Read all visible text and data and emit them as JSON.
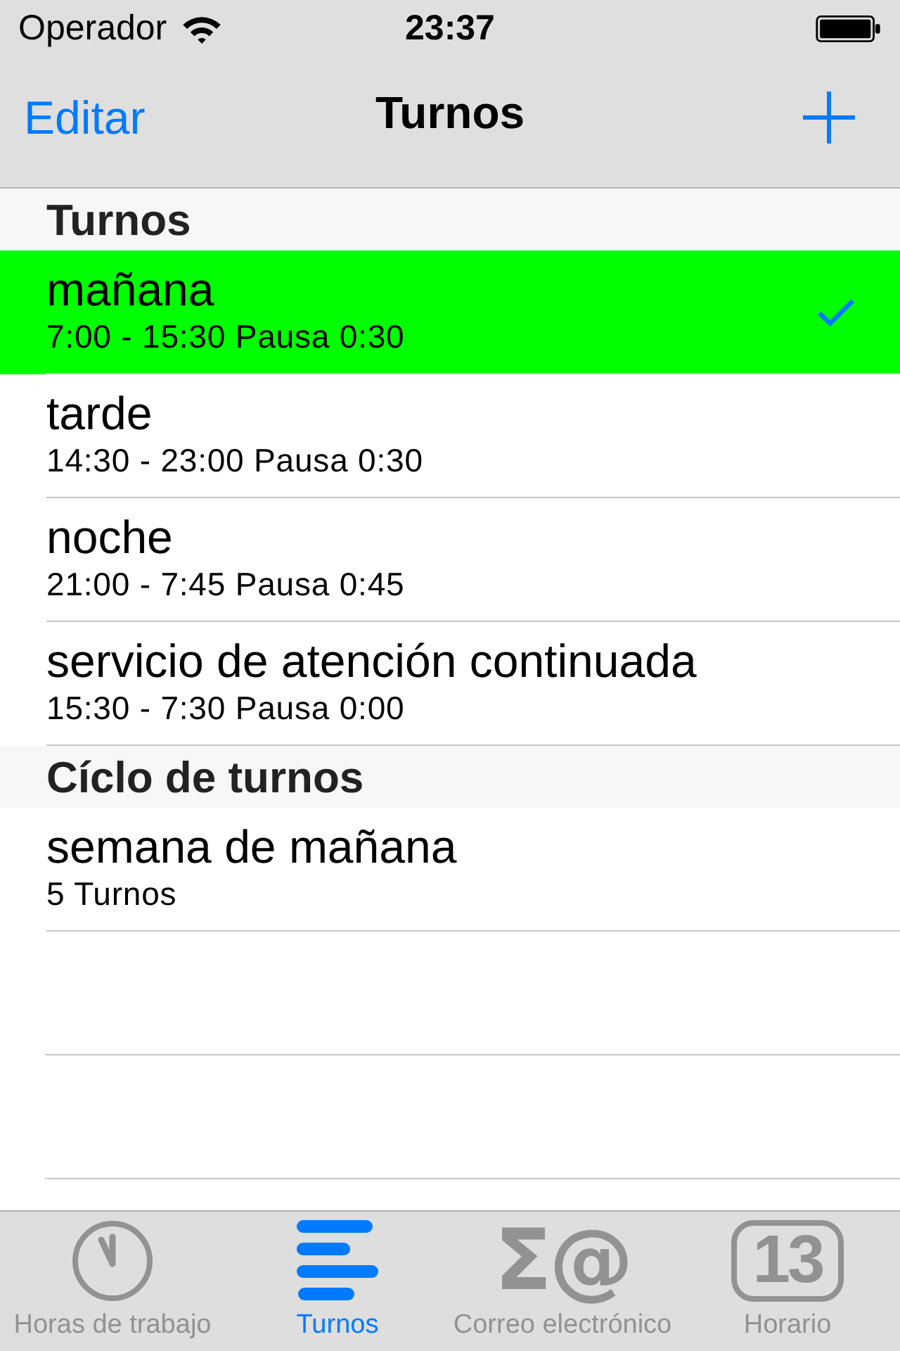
{
  "status_bar": {
    "carrier": "Operador",
    "time": "23:37"
  },
  "nav_bar": {
    "left_button": "Editar",
    "title": "Turnos"
  },
  "sections": [
    {
      "header": "Turnos",
      "rows": [
        {
          "title": "mañana",
          "subtitle": "7:00 - 15:30 Pausa 0:30",
          "selected": true
        },
        {
          "title": "tarde",
          "subtitle": "14:30 - 23:00 Pausa 0:30",
          "selected": false
        },
        {
          "title": "noche",
          "subtitle": "21:00 - 7:45 Pausa 0:45",
          "selected": false
        },
        {
          "title": "servicio de atención continuada",
          "subtitle": "15:30 - 7:30 Pausa 0:00",
          "selected": false
        }
      ]
    },
    {
      "header": "Cíclo de turnos",
      "rows": [
        {
          "title": "semana de mañana",
          "subtitle": "5 Turnos",
          "selected": false
        }
      ]
    }
  ],
  "tab_bar": [
    {
      "label": "Horas de trabajo",
      "kind": "clock",
      "selected": false
    },
    {
      "label": "Turnos",
      "kind": "bars",
      "selected": true
    },
    {
      "label": "Correo electrónico",
      "kind": "glyph",
      "glyph": "Σ@",
      "selected": false
    },
    {
      "label": "Horario",
      "kind": "calendar",
      "glyph": "13",
      "selected": false
    }
  ]
}
